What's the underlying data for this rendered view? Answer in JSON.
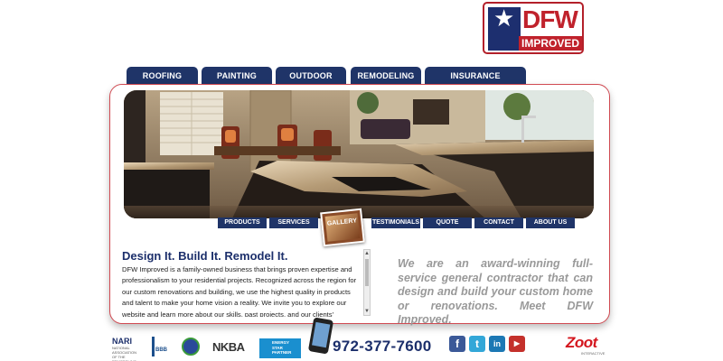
{
  "logo": {
    "line1": "DFW",
    "line2": "IMPROVED",
    "star": "★"
  },
  "top_nav": [
    {
      "label": "ROOFING"
    },
    {
      "label": "PAINTING"
    },
    {
      "label": "OUTDOOR LIVING"
    },
    {
      "label": "REMODELING"
    },
    {
      "label": "INSURANCE RESTORATION"
    }
  ],
  "sub_nav": [
    {
      "label": "PRODUCTS"
    },
    {
      "label": "SERVICES"
    },
    {
      "label": "GALLERY"
    },
    {
      "label": "TESTIMONIALS"
    },
    {
      "label": "QUOTE"
    },
    {
      "label": "CONTACT"
    },
    {
      "label": "ABOUT US"
    }
  ],
  "content": {
    "heading": "Design It. Build It. Remodel It.",
    "body": "DFW Improved is a family-owned business that brings proven expertise and professionalism to your residential projects. Recognized across the region for our custom renovations and building, we use the highest quality in products and talent to make your home vision a reality. We invite you to explore our website and learn more about our skills, past projects, and our clients' experience.",
    "tagline": "We are an award-winning full-service general contractor that can design and build your custom home or renovations. Meet DFW Improved."
  },
  "footer": {
    "nari": "NARI",
    "nari_sub": "NATIONAL ASSOCIATION OF THE REMODELING INDUSTRY",
    "bbb": "BBB",
    "nkba": "NKBA",
    "energy_star": "ENERGY STAR PARTNER",
    "phone": "972-377-7600",
    "social": [
      {
        "name": "facebook",
        "glyph": "f",
        "color": "#3b5998"
      },
      {
        "name": "twitter",
        "glyph": "t",
        "color": "#33a7d8"
      },
      {
        "name": "linkedin",
        "glyph": "in",
        "color": "#1c78b4"
      },
      {
        "name": "youtube",
        "glyph": "▶",
        "color": "#c4302b"
      }
    ],
    "zoot": "Zoot",
    "zoot_sub": "INTERACTIVE"
  },
  "colors": {
    "nav_bg": "#1f3468",
    "brand_red": "#c0222c",
    "heading_blue": "#1c2f6b",
    "tagline_gray": "#999999"
  }
}
